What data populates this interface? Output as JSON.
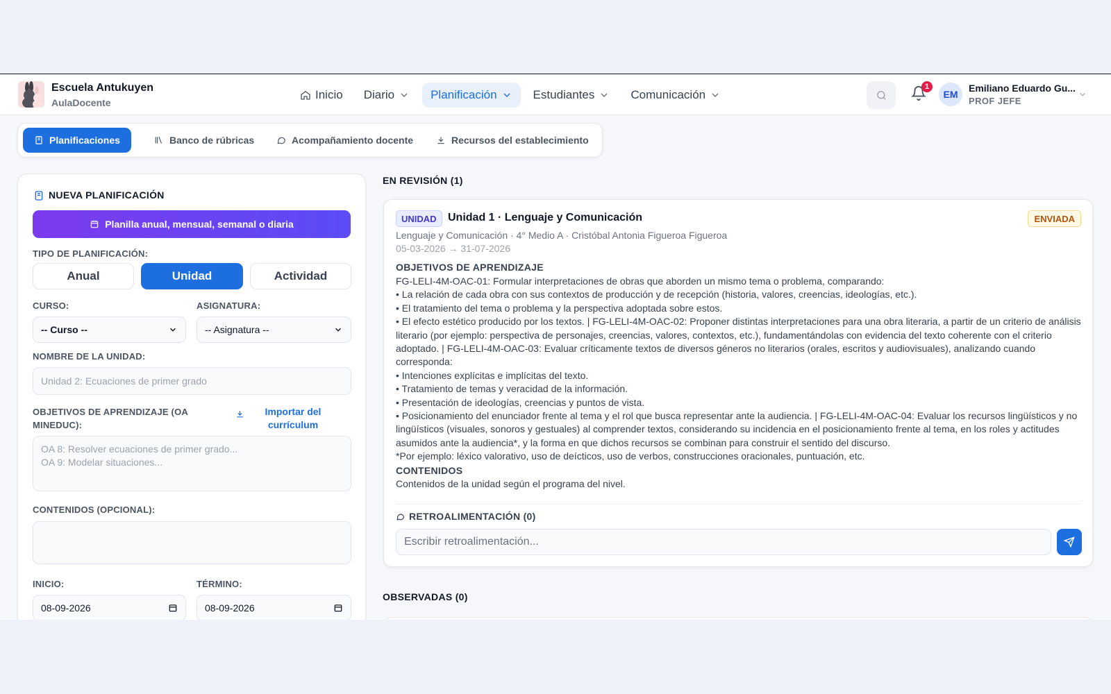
{
  "brand": {
    "name": "Escuela Antukuyen",
    "sub": "AulaDocente"
  },
  "nav": {
    "inicio": "Inicio",
    "diario": "Diario",
    "planificacion": "Planificación",
    "estudiantes": "Estudiantes",
    "comunicacion": "Comunicación"
  },
  "header": {
    "notif_count": "1",
    "avatar": "EM",
    "user_name": "Emiliano Eduardo Gu...",
    "user_role": "PROF JEFE"
  },
  "subtabs": {
    "planificaciones": "Planificaciones",
    "rubricas": "Banco de rúbricas",
    "acompanamiento": "Acompañamiento docente",
    "recursos": "Recursos del establecimiento"
  },
  "form": {
    "title": "NUEVA PLANIFICACIÓN",
    "template_btn": "Planilla anual, mensual, semanal o diaria",
    "tipo_label": "TIPO DE PLANIFICACIÓN:",
    "tipos": [
      "Anual",
      "Unidad",
      "Actividad"
    ],
    "tipo_selected": "Unidad",
    "curso_label": "CURSO:",
    "curso_value": "-- Curso --",
    "asignatura_label": "ASIGNATURA:",
    "asignatura_value": "-- Asignatura --",
    "unidad_label": "NOMBRE DE LA UNIDAD:",
    "unidad_placeholder": "Unidad 2: Ecuaciones de primer grado",
    "oa_label": "OBJETIVOS DE APRENDIZAJE (OA MINEDUC):",
    "import_link": "Importar del currículum",
    "oa_placeholder": "OA 8: Resolver ecuaciones de primer grado...\nOA 9: Modelar situaciones...",
    "contenidos_label": "CONTENIDOS (OPCIONAL):",
    "inicio_label": "INICIO:",
    "inicio_value": "08-09-2026",
    "termino_label": "TÉRMINO:",
    "termino_value": "08-09-2026"
  },
  "review": {
    "heading": "EN REVISIÓN (1)",
    "card": {
      "type_badge": "UNIDAD",
      "title": "Unidad 1 · Lenguaje y Comunicación",
      "status": "ENVIADA",
      "meta": "Lenguaje y Comunicación · 4° Medio A · Cristóbal Antonia Figueroa Figueroa",
      "dates": "05-03-2026 → 31-07-2026",
      "objetivos_heading": "OBJETIVOS DE APRENDIZAJE",
      "objetivos_text": "FG-LELI-4M-OAC-01: Formular interpretaciones de obras que aborden un mismo tema o problema, comparando:\n• La relación de cada obra con sus contextos de producción y de recepción (historia, valores, creencias, ideologías, etc.).\n• El tratamiento del tema o problema y la perspectiva adoptada sobre estos.\n• El efecto estético producido por los textos. | FG-LELI-4M-OAC-02: Proponer distintas interpretaciones para una obra literaria, a partir de un criterio de análisis literario (por ejemplo: perspectiva de personajes, creencias, valores, contextos, etc.), fundamentándolas con evidencia del texto coherente con el criterio adoptado. | FG-LELI-4M-OAC-03: Evaluar críticamente textos de diversos géneros no literarios (orales, escritos y audiovisuales), analizando cuando corresponda:\n• Intenciones explícitas e implícitas del texto.\n• Tratamiento de temas y veracidad de la información.\n• Presentación de ideologías, creencias y puntos de vista.\n• Posicionamiento del enunciador frente al tema y el rol que busca representar ante la audiencia. | FG-LELI-4M-OAC-04: Evaluar los recursos lingüísticos y no lingüísticos (visuales, sonoros y gestuales) al comprender textos, considerando su incidencia en el posicionamiento frente al tema, en los roles y actitudes asumidos ante la audiencia*, y la forma en que dichos recursos se combinan para construir el sentido del discurso.\n*Por ejemplo: léxico valorativo, uso de deícticos, uso de verbos, construcciones oracionales, puntuación, etc.",
      "contenidos_heading": "CONTENIDOS",
      "contenidos_text": "Contenidos de la unidad según el programa del nivel.",
      "feedback_heading": "RETROALIMENTACIÓN (0)",
      "feedback_placeholder": "Escribir retroalimentación..."
    }
  },
  "observed": {
    "heading": "OBSERVADAS (0)"
  },
  "colors": {
    "primary": "#1d6fe0",
    "gradient_start": "#7c3aed",
    "gradient_end": "#5b4cf5",
    "badge_red": "#e11d48"
  }
}
